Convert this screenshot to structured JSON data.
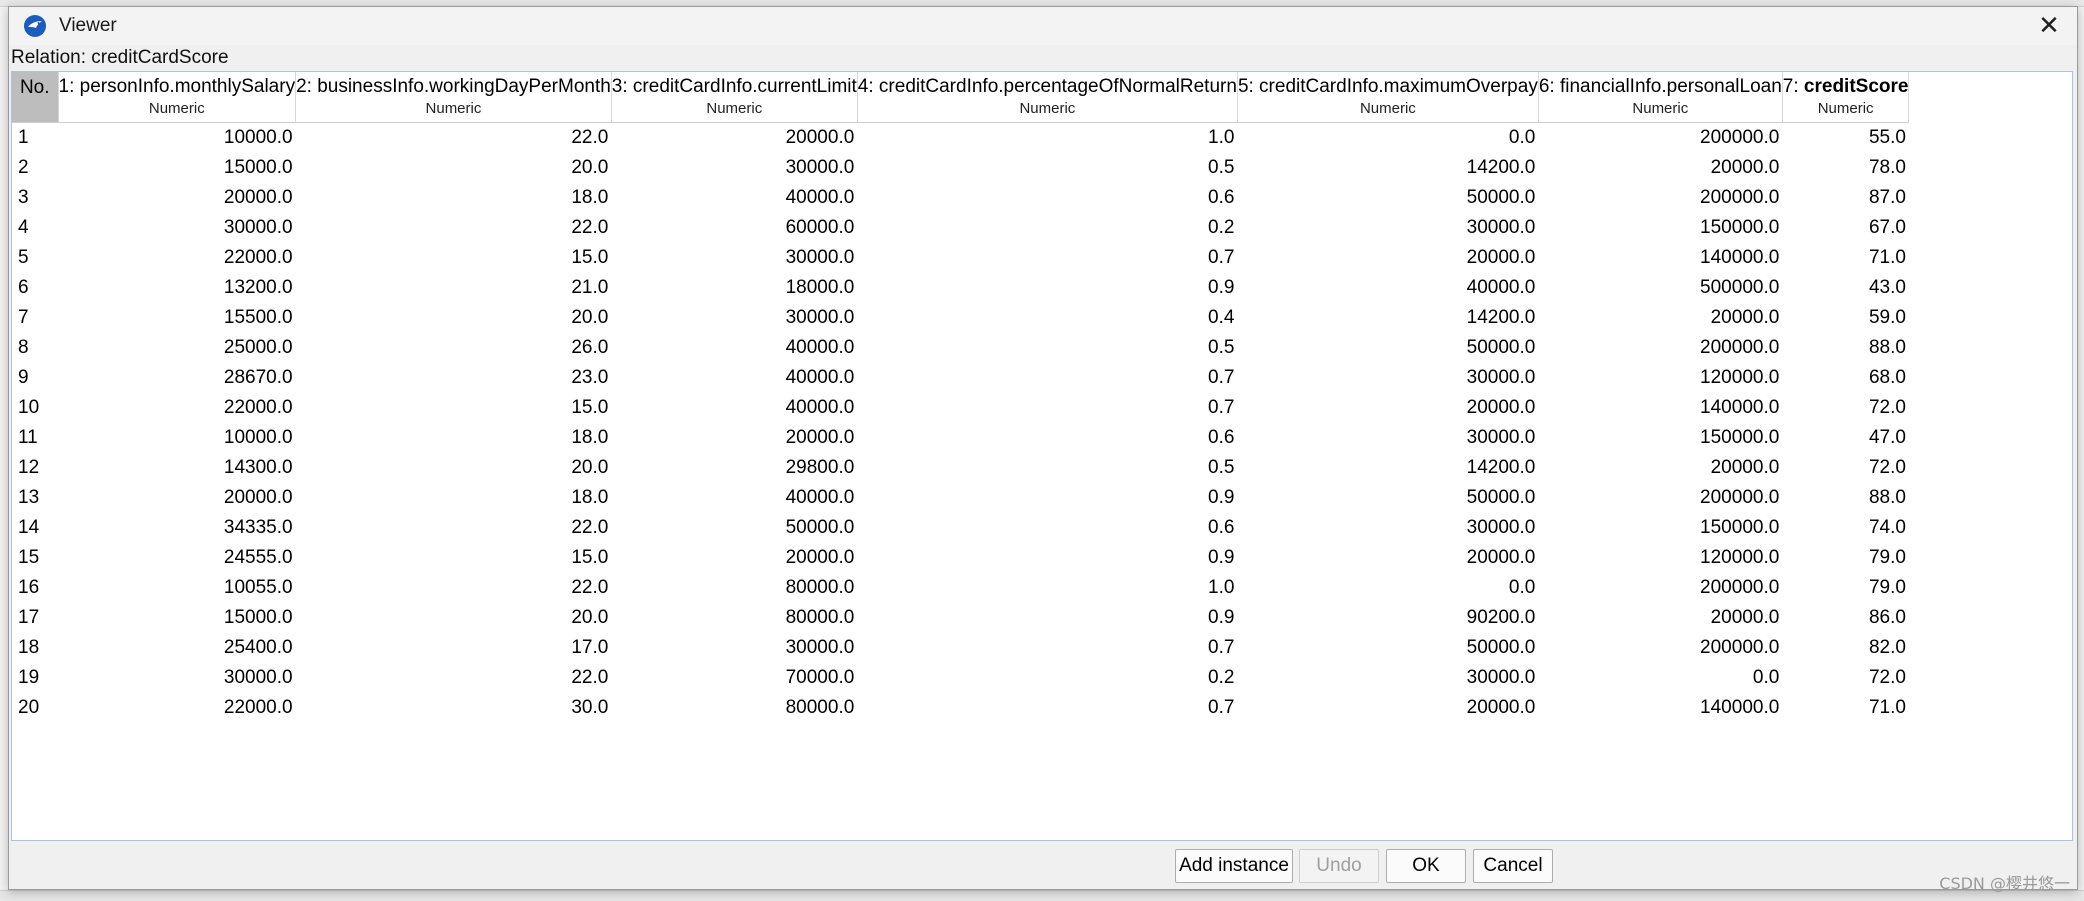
{
  "window": {
    "title": "Viewer",
    "close_glyph": "✕"
  },
  "relation_label": "Relation: creditCardScore",
  "table": {
    "columns": [
      {
        "name": "No.",
        "type": ""
      },
      {
        "name": "1: personInfo.monthlySalary",
        "type": "Numeric"
      },
      {
        "name": "2: businessInfo.workingDayPerMonth",
        "type": "Numeric"
      },
      {
        "name": "3: creditCardInfo.currentLimit",
        "type": "Numeric"
      },
      {
        "name": "4: creditCardInfo.percentageOfNormalReturn",
        "type": "Numeric"
      },
      {
        "name": "5: creditCardInfo.maximumOverpay",
        "type": "Numeric"
      },
      {
        "name": "6: financialInfo.personalLoan",
        "type": "Numeric"
      },
      {
        "name_prefix": "7: ",
        "name_bold": "creditScore",
        "type": "Numeric"
      }
    ],
    "rows": [
      [
        "1",
        "10000.0",
        "22.0",
        "20000.0",
        "1.0",
        "0.0",
        "200000.0",
        "55.0"
      ],
      [
        "2",
        "15000.0",
        "20.0",
        "30000.0",
        "0.5",
        "14200.0",
        "20000.0",
        "78.0"
      ],
      [
        "3",
        "20000.0",
        "18.0",
        "40000.0",
        "0.6",
        "50000.0",
        "200000.0",
        "87.0"
      ],
      [
        "4",
        "30000.0",
        "22.0",
        "60000.0",
        "0.2",
        "30000.0",
        "150000.0",
        "67.0"
      ],
      [
        "5",
        "22000.0",
        "15.0",
        "30000.0",
        "0.7",
        "20000.0",
        "140000.0",
        "71.0"
      ],
      [
        "6",
        "13200.0",
        "21.0",
        "18000.0",
        "0.9",
        "40000.0",
        "500000.0",
        "43.0"
      ],
      [
        "7",
        "15500.0",
        "20.0",
        "30000.0",
        "0.4",
        "14200.0",
        "20000.0",
        "59.0"
      ],
      [
        "8",
        "25000.0",
        "26.0",
        "40000.0",
        "0.5",
        "50000.0",
        "200000.0",
        "88.0"
      ],
      [
        "9",
        "28670.0",
        "23.0",
        "40000.0",
        "0.7",
        "30000.0",
        "120000.0",
        "68.0"
      ],
      [
        "10",
        "22000.0",
        "15.0",
        "40000.0",
        "0.7",
        "20000.0",
        "140000.0",
        "72.0"
      ],
      [
        "11",
        "10000.0",
        "18.0",
        "20000.0",
        "0.6",
        "30000.0",
        "150000.0",
        "47.0"
      ],
      [
        "12",
        "14300.0",
        "20.0",
        "29800.0",
        "0.5",
        "14200.0",
        "20000.0",
        "72.0"
      ],
      [
        "13",
        "20000.0",
        "18.0",
        "40000.0",
        "0.9",
        "50000.0",
        "200000.0",
        "88.0"
      ],
      [
        "14",
        "34335.0",
        "22.0",
        "50000.0",
        "0.6",
        "30000.0",
        "150000.0",
        "74.0"
      ],
      [
        "15",
        "24555.0",
        "15.0",
        "20000.0",
        "0.9",
        "20000.0",
        "120000.0",
        "79.0"
      ],
      [
        "16",
        "10055.0",
        "22.0",
        "80000.0",
        "1.0",
        "0.0",
        "200000.0",
        "79.0"
      ],
      [
        "17",
        "15000.0",
        "20.0",
        "80000.0",
        "0.9",
        "90200.0",
        "20000.0",
        "86.0"
      ],
      [
        "18",
        "25400.0",
        "17.0",
        "30000.0",
        "0.7",
        "50000.0",
        "200000.0",
        "82.0"
      ],
      [
        "19",
        "30000.0",
        "22.0",
        "70000.0",
        "0.2",
        "30000.0",
        "0.0",
        "72.0"
      ],
      [
        "20",
        "22000.0",
        "30.0",
        "80000.0",
        "0.7",
        "20000.0",
        "140000.0",
        "71.0"
      ]
    ]
  },
  "buttons": {
    "add_instance": "Add instance",
    "undo": "Undo",
    "ok": "OK",
    "cancel": "Cancel"
  },
  "watermark": "CSDN @樱井悠一",
  "colors": {
    "header_no_bg": "#bdbdbd",
    "table_border": "#a9c2e2"
  }
}
